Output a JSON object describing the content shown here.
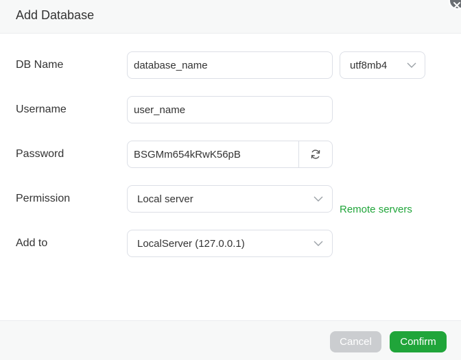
{
  "dialog": {
    "title": "Add Database"
  },
  "form": {
    "db_name": {
      "label": "DB Name",
      "value": "database_name",
      "charset": "utf8mb4"
    },
    "username": {
      "label": "Username",
      "value": "user_name"
    },
    "password": {
      "label": "Password",
      "value": "BSGMm654kRwK56pB"
    },
    "permission": {
      "label": "Permission",
      "selected": "Local server"
    },
    "add_to": {
      "label": "Add to",
      "selected": "LocalServer (127.0.0.1)",
      "remote_link": "Remote servers"
    }
  },
  "footer": {
    "cancel_label": "Cancel",
    "confirm_label": "Confirm"
  },
  "colors": {
    "accent": "#20a53a",
    "cancel_bg": "#cbcdd0",
    "header_bg": "#f7f8f8"
  },
  "icons": {
    "close": "close-icon",
    "chevron": "chevron-down-icon",
    "refresh": "refresh-icon"
  }
}
